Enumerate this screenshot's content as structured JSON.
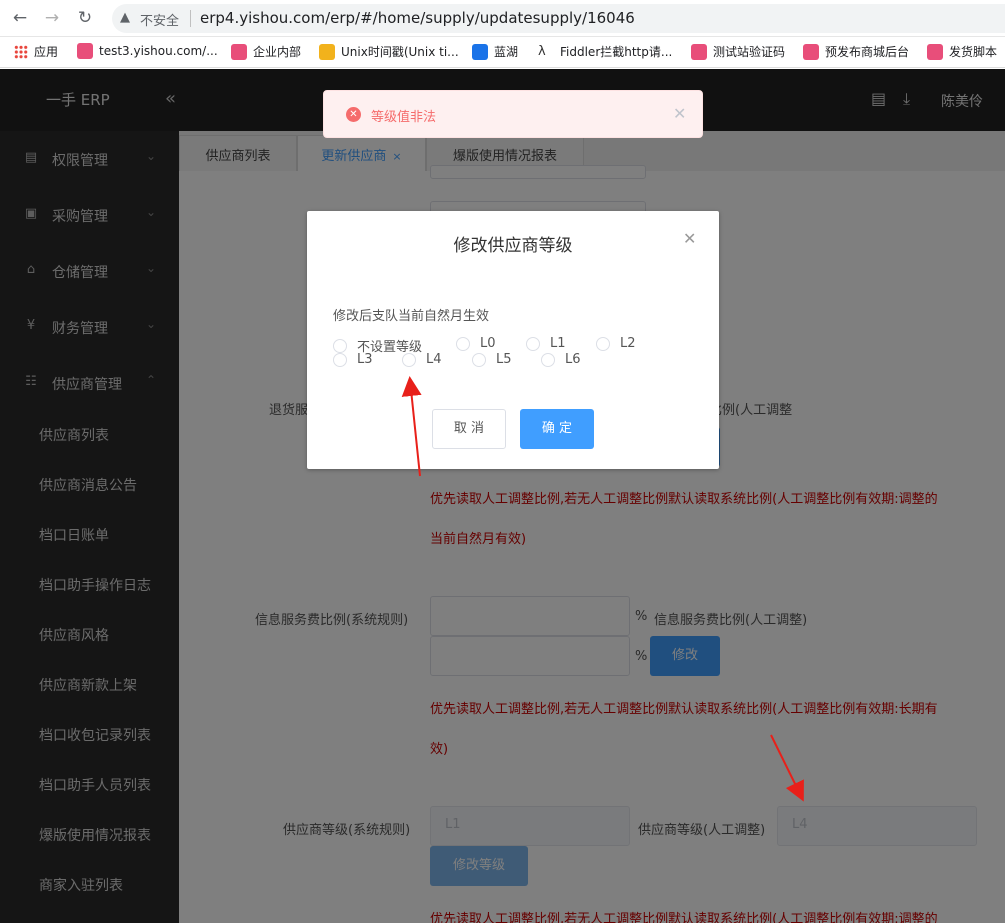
{
  "browser": {
    "security": "不安全",
    "url": "erp4.yishou.com/erp/#/home/supply/updatesupply/16046",
    "bookmarks": [
      {
        "label": "应用",
        "color": "#e8453c"
      },
      {
        "label": "test3.yishou.com/...",
        "color": "#e84e7a"
      },
      {
        "label": "企业内部",
        "color": "#e84e7a"
      },
      {
        "label": "Unix时间戳(Unix ti...",
        "color": "#f2b21c"
      },
      {
        "label": "蓝湖",
        "color": "#1a73e8"
      },
      {
        "label": "Fiddler拦截http请...",
        "color": "#333333"
      },
      {
        "label": "测试站验证码",
        "color": "#e84e7a"
      },
      {
        "label": "预发布商城后台",
        "color": "#e84e7a"
      },
      {
        "label": "发货脚本",
        "color": "#e84e7a"
      }
    ]
  },
  "app": {
    "logo": "一手 ERP",
    "user": "陈美伶"
  },
  "sidebar": {
    "groups": [
      {
        "label": "权限管理",
        "icon": "id-card-icon"
      },
      {
        "label": "采购管理",
        "icon": "cart-icon"
      },
      {
        "label": "仓储管理",
        "icon": "warehouse-icon"
      },
      {
        "label": "财务管理",
        "icon": "yen-icon"
      },
      {
        "label": "供应商管理",
        "icon": "supplier-icon"
      }
    ],
    "sub_items": [
      "供应商列表",
      "供应商消息公告",
      "档口日账单",
      "档口助手操作日志",
      "供应商风格",
      "供应商新款上架",
      "档口收包记录列表",
      "档口助手人员列表",
      "爆版使用情况报表",
      "商家入驻列表"
    ]
  },
  "tabs": [
    {
      "label": "供应商列表"
    },
    {
      "label": "更新供应商",
      "close": "×"
    },
    {
      "label": "爆版使用情况报表"
    }
  ],
  "form": {
    "return_label_partial": "退货服",
    "return_right_label_partial": "比例(人工调整",
    "note1_line1": "优先读取人工调整比例,若无人工调整比例默认读取系统比例(人工调整比例有效期:调整的",
    "note1_line2": "当前自然月有效)",
    "info_fee_label": "信息服务费比例(系统规则)",
    "percent": "%",
    "info_fee_manual_label": "信息服务费比例(人工调整)",
    "modify_button": "修改",
    "note2_line1": "优先读取人工调整比例,若无人工调整比例默认读取系统比例(人工调整比例有效期:长期有",
    "note2_line2": "效)",
    "level_label": "供应商等级(系统规则)",
    "level_value": "L1",
    "level_manual_label": "供应商等级(人工调整)",
    "level_manual_value": "L4",
    "modify_level_button": "修改等级",
    "note3_line1": "优先读取人工调整比例,若无人工调整比例默认读取系统比例(人工调整比例有效期:调整的"
  },
  "toast": {
    "message": "等级值非法"
  },
  "dialog": {
    "title": "修改供应商等级",
    "description": "修改后支队当前自然月生效",
    "options": [
      "不设置等级",
      "L0",
      "L1",
      "L2",
      "L3",
      "L4",
      "L5",
      "L6"
    ],
    "cancel": "取 消",
    "confirm": "确 定"
  }
}
